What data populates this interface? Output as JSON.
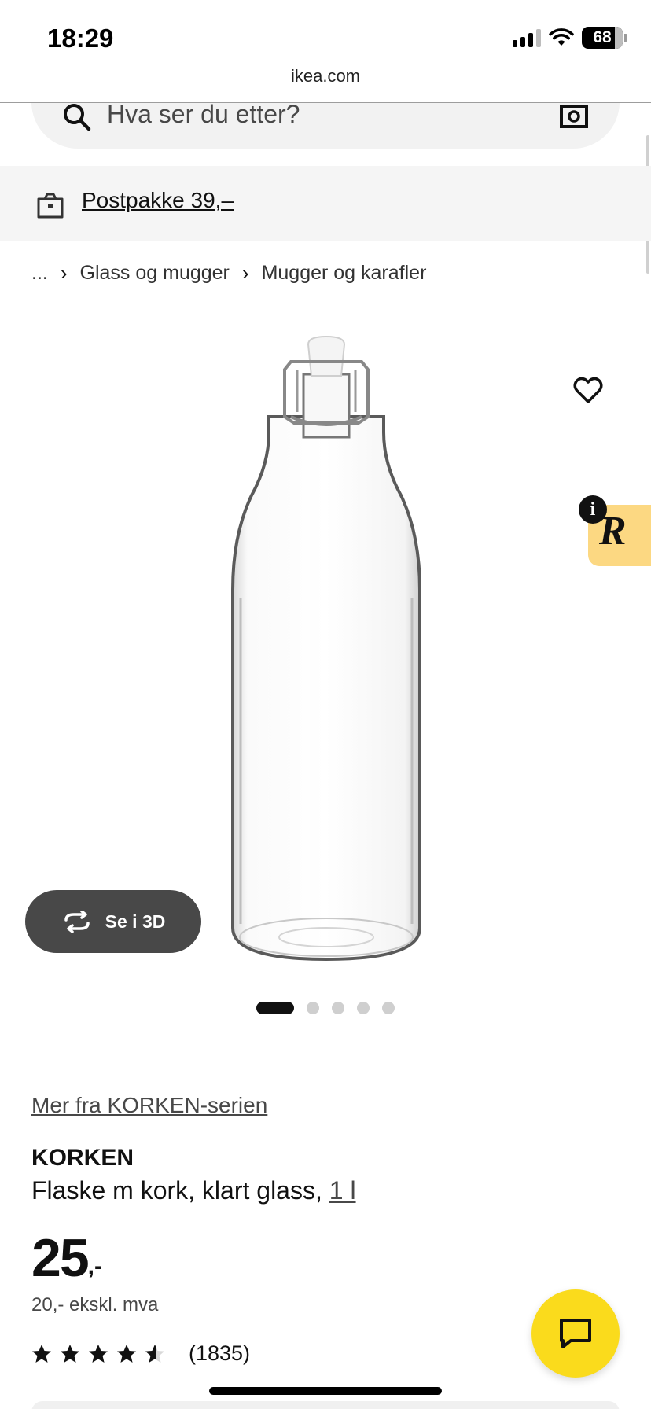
{
  "status_bar": {
    "time": "18:29",
    "battery": "68",
    "icons": [
      "cellular-signal-icon",
      "wifi-icon",
      "battery-icon"
    ]
  },
  "browser": {
    "url": "ikea.com"
  },
  "search": {
    "placeholder": "Hva ser du etter?",
    "icons": [
      "search-icon",
      "camera-icon"
    ]
  },
  "delivery": {
    "text": "Postpakke 39,–",
    "icon": "delivery-box-icon"
  },
  "breadcrumb": {
    "items": [
      "...",
      "Glass og mugger",
      "Mugger og karafler"
    ]
  },
  "product_media": {
    "view_3d_label": "Se i 3D",
    "badge_letter": "R",
    "info_letter": "i",
    "dots_total": 5,
    "dots_active_index": 0,
    "icons": [
      "heart-icon",
      "rotate-3d-icon",
      "rakuten-icon",
      "info-icon"
    ]
  },
  "product": {
    "series_link": "Mer fra KORKEN-serien",
    "name": "KORKEN",
    "description": "Flaske m kork, klart glass, ",
    "size": "1 l",
    "price": "25",
    "price_suffix": ",-",
    "price_ex_vat": "20,- ekskl. mva",
    "rating_value": 4.5,
    "rating_count": "(1835)"
  },
  "chat": {
    "icon": "chat-icon",
    "color": "#FADB1C"
  },
  "colors": {
    "ikea_yellow": "#FADB1C",
    "badge_yellow": "#FCD882",
    "text_dark": "#111111",
    "text_grey": "#484848"
  }
}
